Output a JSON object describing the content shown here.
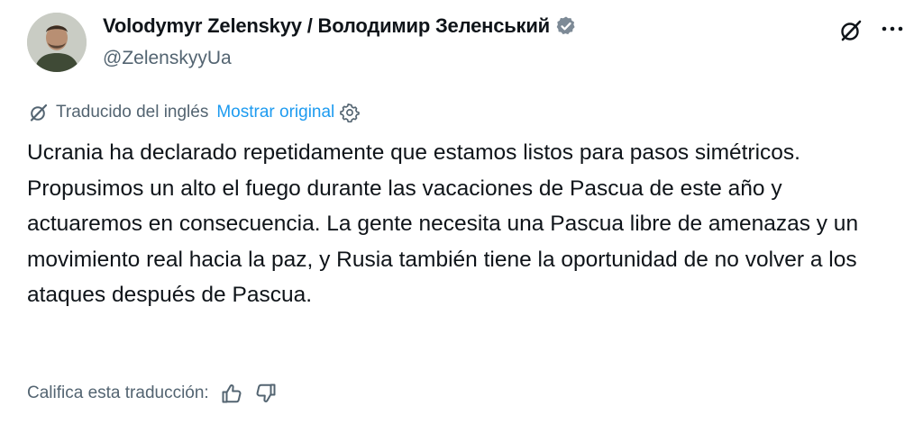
{
  "author": {
    "display_name": "Volodymyr Zelenskyy / Володимир Зеленський",
    "handle": "@ZelenskyyUa",
    "verified": true
  },
  "translation": {
    "status_label": "Traducido del inglés",
    "show_original_label": "Mostrar original"
  },
  "tweet": {
    "text": "Ucrania ha declarado repetidamente que estamos listos para pasos simétricos. Propusimos un alto el fuego durante las vacaciones de Pascua de este año y actuaremos en consecuencia. La gente necesita una Pascua libre de amenazas y un movimiento real hacia la paz, y Rusia también tiene la oportunidad de no volver a los ataques después de Pascua."
  },
  "rating": {
    "label": "Califica esta traducción:"
  },
  "colors": {
    "accent": "#1d9bf0",
    "secondary_text": "#536471",
    "primary_text": "#0f1419"
  }
}
